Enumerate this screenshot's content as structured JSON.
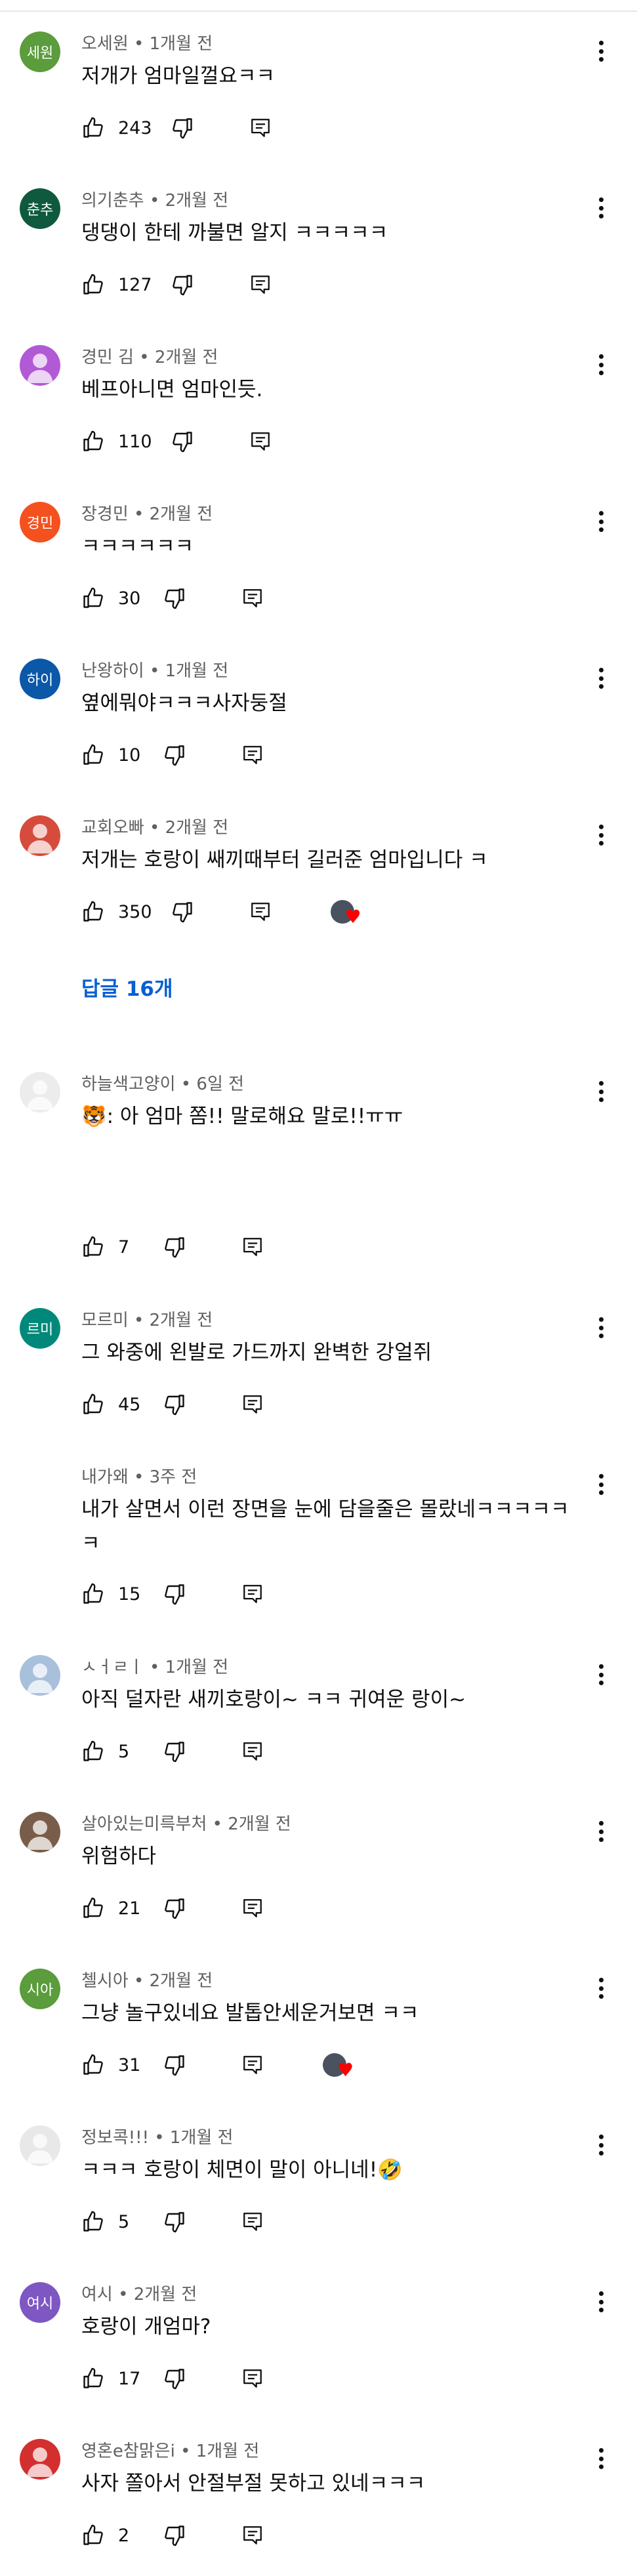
{
  "replies_link": "답글 16개",
  "colors": {
    "accent": "#065fd4",
    "heart": "#ff0000",
    "meta": "#606060"
  },
  "icons": {
    "like": "thumb-up-icon",
    "dislike": "thumb-down-icon",
    "reply": "reply-icon",
    "more": "more-vert-icon"
  },
  "comments": [
    {
      "avatar_text": "세원",
      "avatar_color": "#5b9c3c",
      "author": "오세원",
      "time": "1개월 전",
      "text": "저개가 엄마일껄요ㅋㅋ",
      "likes": "243"
    },
    {
      "avatar_text": "춘추",
      "avatar_color": "#0f5a3f",
      "author": "의기춘추",
      "time": "2개월 전",
      "text": "댕댕이 한테 까불면 알지 ㅋㅋㅋㅋㅋ",
      "likes": "127"
    },
    {
      "avatar_text": "",
      "avatar_color": "#b25ad6",
      "author": "경민 김",
      "time": "2개월 전",
      "text": "베프아니면 엄마인듯.",
      "likes": "110"
    },
    {
      "avatar_text": "경민",
      "avatar_color": "#f4511e",
      "author": "장경민",
      "time": "2개월 전",
      "text": "ㅋㅋㅋㅋㅋㅋ",
      "likes": "30"
    },
    {
      "avatar_text": "하이",
      "avatar_color": "#0b57a8",
      "author": "난왕하이",
      "time": "1개월 전",
      "text": "옆에뭐야ㅋㅋㅋ사자둥절",
      "likes": "10"
    },
    {
      "avatar_text": "",
      "avatar_color": "#d64c3c",
      "author": "교회오빠",
      "time": "2개월 전",
      "text": "저개는 호랑이 쌔끼때부터 길러준 엄마입니다 ㅋ",
      "likes": "350",
      "hearted": true
    },
    {
      "avatar_text": "",
      "avatar_color": "#ececec",
      "author": "하늘색고양이",
      "time": "6일 전",
      "text": "🐯: 아 엄마 쫌!! 말로해요 말로!!ㅠㅠ",
      "likes": "7"
    },
    {
      "avatar_text": "르미",
      "avatar_color": "#00897b",
      "author": "모르미",
      "time": "2개월 전",
      "text": "그 와중에 왼발로 가드까지 완벽한 강얼쥐",
      "likes": "45"
    },
    {
      "avatar_text": "",
      "avatar_color": "#ffffff",
      "author": "내가왜",
      "time": "3주 전",
      "text": "내가 살면서 이런 장면을 눈에 담을줄은 몰랐네ㅋㅋㅋㅋㅋㅋ",
      "likes": "15"
    },
    {
      "avatar_text": "",
      "avatar_color": "#a9c0dc",
      "author": "ㅅㅓㄹㅣ",
      "time": "1개월 전",
      "text": "아직 덜자란 새끼호랑이~ ㅋㅋ 귀여운 랑이~",
      "likes": "5"
    },
    {
      "avatar_text": "",
      "avatar_color": "#7a5c4a",
      "author": "살아있는미륵부처",
      "time": "2개월 전",
      "text": "위험하다",
      "likes": "21"
    },
    {
      "avatar_text": "시아",
      "avatar_color": "#5b9c3c",
      "author": "첼시아",
      "time": "2개월 전",
      "text": "그냥 놀구있네요 발톱안세운거보면 ㅋㅋ",
      "likes": "31",
      "hearted": true
    },
    {
      "avatar_text": "",
      "avatar_color": "#e8e8e8",
      "author": "정보콕!!!",
      "time": "1개월 전",
      "text": "ㅋㅋㅋ 호랑이 체면이 말이 아니네!🤣",
      "likes": "5"
    },
    {
      "avatar_text": "여시",
      "avatar_color": "#7e57c2",
      "author": "여시",
      "time": "2개월 전",
      "text": "호랑이 개엄마?",
      "likes": "17"
    },
    {
      "avatar_text": "",
      "avatar_color": "#d32f2f",
      "author": "영혼e참맑은i",
      "time": "1개월 전",
      "text": "사자 쫄아서 안절부절 못하고 있네ㅋㅋㅋ",
      "likes": "2"
    }
  ]
}
